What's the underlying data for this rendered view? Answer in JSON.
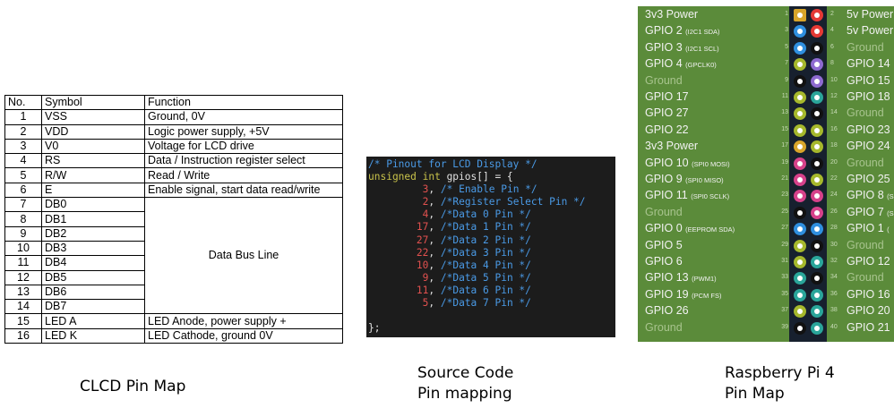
{
  "clcd": {
    "headers": [
      "No.",
      "Symbol",
      "Function"
    ],
    "rows": [
      {
        "no": "1",
        "symbol": "VSS",
        "function": "Ground, 0V"
      },
      {
        "no": "2",
        "symbol": "VDD",
        "function": "Logic power supply, +5V"
      },
      {
        "no": "3",
        "symbol": "V0",
        "function": "Voltage for LCD drive"
      },
      {
        "no": "4",
        "symbol": "RS",
        "function": "Data / Instruction register select"
      },
      {
        "no": "5",
        "symbol": "R/W",
        "function": "Read / Write"
      },
      {
        "no": "6",
        "symbol": "E",
        "function": "Enable signal, start data read/write"
      },
      {
        "no": "7",
        "symbol": "DB0"
      },
      {
        "no": "8",
        "symbol": "DB1"
      },
      {
        "no": "9",
        "symbol": "DB2"
      },
      {
        "no": "10",
        "symbol": "DB3"
      },
      {
        "no": "11",
        "symbol": "DB4"
      },
      {
        "no": "12",
        "symbol": "DB5"
      },
      {
        "no": "13",
        "symbol": "DB6"
      },
      {
        "no": "14",
        "symbol": "DB7"
      },
      {
        "no": "15",
        "symbol": "LED A",
        "function": "LED Anode, power supply +"
      },
      {
        "no": "16",
        "symbol": "LED K",
        "function": "LED Cathode, ground 0V"
      }
    ],
    "bus_label": "Data Bus Line"
  },
  "code": {
    "comment_header": "/* Pinout for LCD Display */",
    "decl_type": "unsigned int",
    "decl_rest": " gpios[] = {",
    "entries": [
      {
        "num": "3",
        "comment": " /* Enable Pin */"
      },
      {
        "num": "2",
        "comment": " /*Register Select Pin */"
      },
      {
        "num": "4",
        "comment": " /*Data 0 Pin */"
      },
      {
        "num": "17",
        "comment": " /*Data 1 Pin */"
      },
      {
        "num": "27",
        "comment": " /*Data 2 Pin */"
      },
      {
        "num": "22",
        "comment": " /*Data 3 Pin */"
      },
      {
        "num": "10",
        "comment": " /*Data 4 Pin */"
      },
      {
        "num": "9",
        "comment": " /*Data 5 Pin */"
      },
      {
        "num": "11",
        "comment": " /*Data 6 Pin */"
      },
      {
        "num": "5",
        "comment": " /*Data 7 Pin */"
      }
    ],
    "closing": "};"
  },
  "rpi": {
    "rows": [
      {
        "left": {
          "main": "3v3 Power",
          "sub": "",
          "pin": "1",
          "color": "#d8a42a",
          "shape": "square"
        },
        "right": {
          "main": "5v Power",
          "sub": "",
          "pin": "2",
          "color": "#e53935"
        }
      },
      {
        "left": {
          "main": "GPIO 2",
          "sub": "(I2C1 SDA)",
          "pin": "3",
          "color": "#2f8fe0"
        },
        "right": {
          "main": "5v Power",
          "sub": "",
          "pin": "4",
          "color": "#e53935"
        }
      },
      {
        "left": {
          "main": "GPIO 3",
          "sub": "(I2C1 SCL)",
          "pin": "5",
          "color": "#2f8fe0"
        },
        "right": {
          "main": "Ground",
          "sub": "",
          "pin": "6",
          "color": "#111111",
          "ground": true
        }
      },
      {
        "left": {
          "main": "GPIO 4",
          "sub": "(GPCLK0)",
          "pin": "7",
          "color": "#a6b82c"
        },
        "right": {
          "main": "GPIO 14",
          "sub": "",
          "pin": "8",
          "color": "#8e6ad0"
        }
      },
      {
        "left": {
          "main": "Ground",
          "sub": "",
          "pin": "9",
          "color": "#111111",
          "ground": true
        },
        "right": {
          "main": "GPIO 15",
          "sub": "",
          "pin": "10",
          "color": "#8e6ad0"
        }
      },
      {
        "left": {
          "main": "GPIO 17",
          "sub": "",
          "pin": "11",
          "color": "#a6b82c"
        },
        "right": {
          "main": "GPIO 18",
          "sub": "",
          "pin": "12",
          "color": "#2aa59a"
        }
      },
      {
        "left": {
          "main": "GPIO 27",
          "sub": "",
          "pin": "13",
          "color": "#a6b82c"
        },
        "right": {
          "main": "Ground",
          "sub": "",
          "pin": "14",
          "color": "#111111",
          "ground": true
        }
      },
      {
        "left": {
          "main": "GPIO 22",
          "sub": "",
          "pin": "15",
          "color": "#a6b82c"
        },
        "right": {
          "main": "GPIO 23",
          "sub": "",
          "pin": "16",
          "color": "#a6b82c"
        }
      },
      {
        "left": {
          "main": "3v3 Power",
          "sub": "",
          "pin": "17",
          "color": "#d8a42a"
        },
        "right": {
          "main": "GPIO 24",
          "sub": "",
          "pin": "18",
          "color": "#a6b82c"
        }
      },
      {
        "left": {
          "main": "GPIO 10",
          "sub": "(SPI0 MOSI)",
          "pin": "19",
          "color": "#d6418a"
        },
        "right": {
          "main": "Ground",
          "sub": "",
          "pin": "20",
          "color": "#111111",
          "ground": true
        }
      },
      {
        "left": {
          "main": "GPIO 9",
          "sub": "(SPI0 MISO)",
          "pin": "21",
          "color": "#d6418a"
        },
        "right": {
          "main": "GPIO 25",
          "sub": "",
          "pin": "22",
          "color": "#a6b82c"
        }
      },
      {
        "left": {
          "main": "GPIO 11",
          "sub": "(SPI0 SCLK)",
          "pin": "23",
          "color": "#d6418a"
        },
        "right": {
          "main": "GPIO 8",
          "sub": "(S",
          "pin": "24",
          "color": "#d6418a"
        }
      },
      {
        "left": {
          "main": "Ground",
          "sub": "",
          "pin": "25",
          "color": "#111111",
          "ground": true
        },
        "right": {
          "main": "GPIO 7",
          "sub": "(S",
          "pin": "26",
          "color": "#d6418a"
        }
      },
      {
        "left": {
          "main": "GPIO 0",
          "sub": "(EEPROM SDA)",
          "pin": "27",
          "color": "#2f8fe0"
        },
        "right": {
          "main": "GPIO 1",
          "sub": "(",
          "pin": "28",
          "color": "#2f8fe0"
        }
      },
      {
        "left": {
          "main": "GPIO 5",
          "sub": "",
          "pin": "29",
          "color": "#a6b82c"
        },
        "right": {
          "main": "Ground",
          "sub": "",
          "pin": "30",
          "color": "#111111",
          "ground": true
        }
      },
      {
        "left": {
          "main": "GPIO 6",
          "sub": "",
          "pin": "31",
          "color": "#a6b82c"
        },
        "right": {
          "main": "GPIO 12",
          "sub": "",
          "pin": "32",
          "color": "#2aa59a"
        }
      },
      {
        "left": {
          "main": "GPIO 13",
          "sub": "(PWM1)",
          "pin": "33",
          "color": "#2aa59a"
        },
        "right": {
          "main": "Ground",
          "sub": "",
          "pin": "34",
          "color": "#111111",
          "ground": true
        }
      },
      {
        "left": {
          "main": "GPIO 19",
          "sub": "(PCM FS)",
          "pin": "35",
          "color": "#2aa59a"
        },
        "right": {
          "main": "GPIO 16",
          "sub": "",
          "pin": "36",
          "color": "#2aa59a"
        }
      },
      {
        "left": {
          "main": "GPIO 26",
          "sub": "",
          "pin": "37",
          "color": "#a6b82c"
        },
        "right": {
          "main": "GPIO 20",
          "sub": "",
          "pin": "38",
          "color": "#2aa59a"
        }
      },
      {
        "left": {
          "main": "Ground",
          "sub": "",
          "pin": "39",
          "color": "#111111",
          "ground": true
        },
        "right": {
          "main": "GPIO 21",
          "sub": "",
          "pin": "40",
          "color": "#2aa59a"
        }
      }
    ]
  },
  "captions": {
    "clcd": "CLCD Pin Map",
    "code_line1": "Source Code",
    "code_line2": "Pin mapping",
    "rpi_line1": "Raspberry Pi 4",
    "rpi_line2": "Pin Map"
  }
}
